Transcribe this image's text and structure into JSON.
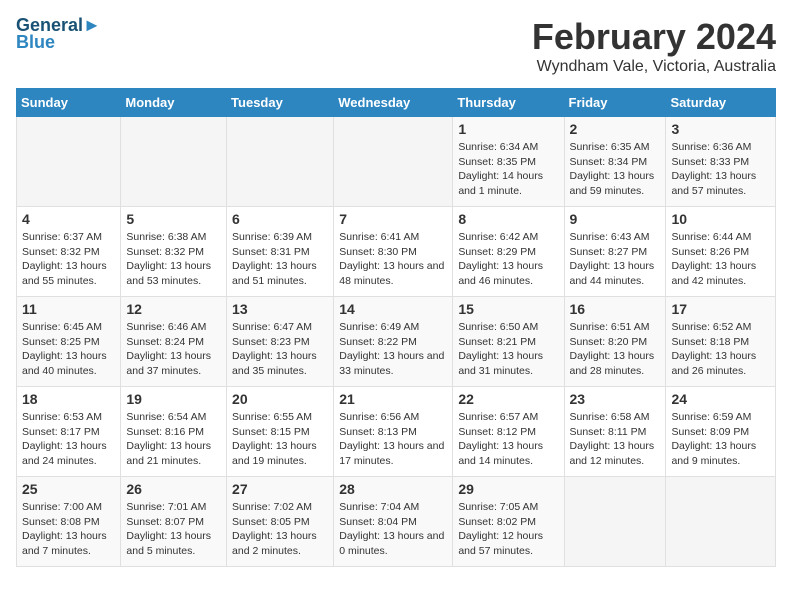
{
  "logo": {
    "line1": "General",
    "line2": "Blue"
  },
  "title": "February 2024",
  "subtitle": "Wyndham Vale, Victoria, Australia",
  "days_of_week": [
    "Sunday",
    "Monday",
    "Tuesday",
    "Wednesday",
    "Thursday",
    "Friday",
    "Saturday"
  ],
  "weeks": [
    [
      {
        "day": "",
        "empty": true
      },
      {
        "day": "",
        "empty": true
      },
      {
        "day": "",
        "empty": true
      },
      {
        "day": "",
        "empty": true
      },
      {
        "day": "1",
        "sunrise": "6:34 AM",
        "sunset": "8:35 PM",
        "daylight": "14 hours and 1 minute."
      },
      {
        "day": "2",
        "sunrise": "6:35 AM",
        "sunset": "8:34 PM",
        "daylight": "13 hours and 59 minutes."
      },
      {
        "day": "3",
        "sunrise": "6:36 AM",
        "sunset": "8:33 PM",
        "daylight": "13 hours and 57 minutes."
      }
    ],
    [
      {
        "day": "4",
        "sunrise": "6:37 AM",
        "sunset": "8:32 PM",
        "daylight": "13 hours and 55 minutes."
      },
      {
        "day": "5",
        "sunrise": "6:38 AM",
        "sunset": "8:32 PM",
        "daylight": "13 hours and 53 minutes."
      },
      {
        "day": "6",
        "sunrise": "6:39 AM",
        "sunset": "8:31 PM",
        "daylight": "13 hours and 51 minutes."
      },
      {
        "day": "7",
        "sunrise": "6:41 AM",
        "sunset": "8:30 PM",
        "daylight": "13 hours and 48 minutes."
      },
      {
        "day": "8",
        "sunrise": "6:42 AM",
        "sunset": "8:29 PM",
        "daylight": "13 hours and 46 minutes."
      },
      {
        "day": "9",
        "sunrise": "6:43 AM",
        "sunset": "8:27 PM",
        "daylight": "13 hours and 44 minutes."
      },
      {
        "day": "10",
        "sunrise": "6:44 AM",
        "sunset": "8:26 PM",
        "daylight": "13 hours and 42 minutes."
      }
    ],
    [
      {
        "day": "11",
        "sunrise": "6:45 AM",
        "sunset": "8:25 PM",
        "daylight": "13 hours and 40 minutes."
      },
      {
        "day": "12",
        "sunrise": "6:46 AM",
        "sunset": "8:24 PM",
        "daylight": "13 hours and 37 minutes."
      },
      {
        "day": "13",
        "sunrise": "6:47 AM",
        "sunset": "8:23 PM",
        "daylight": "13 hours and 35 minutes."
      },
      {
        "day": "14",
        "sunrise": "6:49 AM",
        "sunset": "8:22 PM",
        "daylight": "13 hours and 33 minutes."
      },
      {
        "day": "15",
        "sunrise": "6:50 AM",
        "sunset": "8:21 PM",
        "daylight": "13 hours and 31 minutes."
      },
      {
        "day": "16",
        "sunrise": "6:51 AM",
        "sunset": "8:20 PM",
        "daylight": "13 hours and 28 minutes."
      },
      {
        "day": "17",
        "sunrise": "6:52 AM",
        "sunset": "8:18 PM",
        "daylight": "13 hours and 26 minutes."
      }
    ],
    [
      {
        "day": "18",
        "sunrise": "6:53 AM",
        "sunset": "8:17 PM",
        "daylight": "13 hours and 24 minutes."
      },
      {
        "day": "19",
        "sunrise": "6:54 AM",
        "sunset": "8:16 PM",
        "daylight": "13 hours and 21 minutes."
      },
      {
        "day": "20",
        "sunrise": "6:55 AM",
        "sunset": "8:15 PM",
        "daylight": "13 hours and 19 minutes."
      },
      {
        "day": "21",
        "sunrise": "6:56 AM",
        "sunset": "8:13 PM",
        "daylight": "13 hours and 17 minutes."
      },
      {
        "day": "22",
        "sunrise": "6:57 AM",
        "sunset": "8:12 PM",
        "daylight": "13 hours and 14 minutes."
      },
      {
        "day": "23",
        "sunrise": "6:58 AM",
        "sunset": "8:11 PM",
        "daylight": "13 hours and 12 minutes."
      },
      {
        "day": "24",
        "sunrise": "6:59 AM",
        "sunset": "8:09 PM",
        "daylight": "13 hours and 9 minutes."
      }
    ],
    [
      {
        "day": "25",
        "sunrise": "7:00 AM",
        "sunset": "8:08 PM",
        "daylight": "13 hours and 7 minutes."
      },
      {
        "day": "26",
        "sunrise": "7:01 AM",
        "sunset": "8:07 PM",
        "daylight": "13 hours and 5 minutes."
      },
      {
        "day": "27",
        "sunrise": "7:02 AM",
        "sunset": "8:05 PM",
        "daylight": "13 hours and 2 minutes."
      },
      {
        "day": "28",
        "sunrise": "7:04 AM",
        "sunset": "8:04 PM",
        "daylight": "13 hours and 0 minutes."
      },
      {
        "day": "29",
        "sunrise": "7:05 AM",
        "sunset": "8:02 PM",
        "daylight": "12 hours and 57 minutes."
      },
      {
        "day": "",
        "empty": true
      },
      {
        "day": "",
        "empty": true
      }
    ]
  ]
}
